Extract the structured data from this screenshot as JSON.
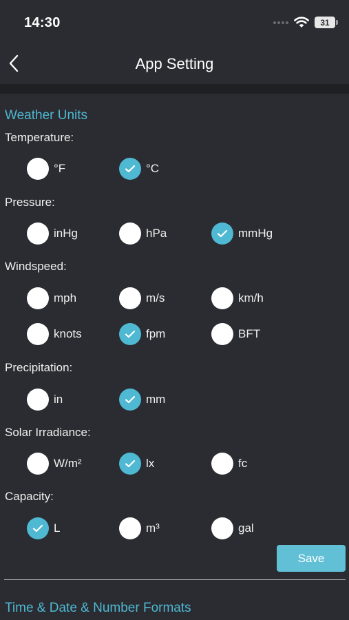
{
  "status_bar": {
    "time": "14:30",
    "battery": "31"
  },
  "nav": {
    "title": "App Setting"
  },
  "weather_units": {
    "title": "Weather Units",
    "groups": [
      {
        "label": "Temperature:",
        "options": [
          {
            "label": "°F",
            "checked": false
          },
          {
            "label": "°C",
            "checked": true
          }
        ]
      },
      {
        "label": "Pressure:",
        "options": [
          {
            "label": "inHg",
            "checked": false
          },
          {
            "label": "hPa",
            "checked": false
          },
          {
            "label": "mmHg",
            "checked": true
          }
        ]
      },
      {
        "label": "Windspeed:",
        "options": [
          {
            "label": "mph",
            "checked": false
          },
          {
            "label": "m/s",
            "checked": false
          },
          {
            "label": "km/h",
            "checked": false
          },
          {
            "label": "knots",
            "checked": false
          },
          {
            "label": "fpm",
            "checked": true
          },
          {
            "label": "BFT",
            "checked": false
          }
        ]
      },
      {
        "label": "Precipitation:",
        "options": [
          {
            "label": "in",
            "checked": false
          },
          {
            "label": "mm",
            "checked": true
          }
        ]
      },
      {
        "label": "Solar Irradiance:",
        "options": [
          {
            "label": "W/m²",
            "checked": false
          },
          {
            "label": "lx",
            "checked": true
          },
          {
            "label": "fc",
            "checked": false
          }
        ]
      },
      {
        "label": "Capacity:",
        "options": [
          {
            "label": "L",
            "checked": true
          },
          {
            "label": "m³",
            "checked": false
          },
          {
            "label": "gal",
            "checked": false
          }
        ]
      }
    ],
    "save_label": "Save"
  },
  "time_formats": {
    "title": "Time & Date & Number Formats"
  },
  "colors": {
    "accent": "#4fb8d3",
    "background": "#2a2c31",
    "save_button": "#61bfd6"
  }
}
